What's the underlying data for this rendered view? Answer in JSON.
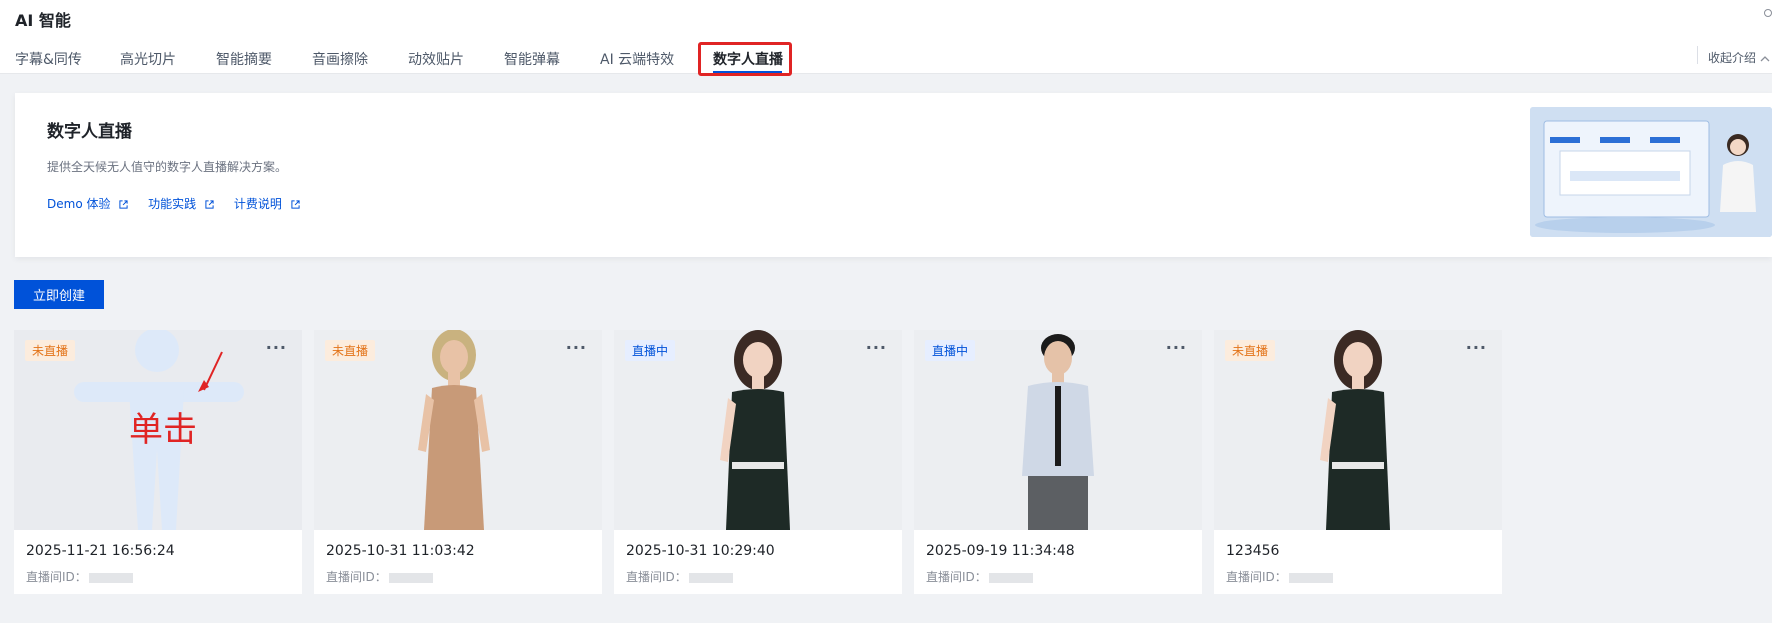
{
  "header": {
    "title": "AI 智能",
    "tabs": [
      {
        "label": "字幕&同传"
      },
      {
        "label": "高光切片"
      },
      {
        "label": "智能摘要"
      },
      {
        "label": "音画擦除"
      },
      {
        "label": "动效贴片"
      },
      {
        "label": "智能弹幕"
      },
      {
        "label": "AI 云端特效"
      },
      {
        "label": "数字人直播"
      }
    ],
    "active_tab": "数字人直播",
    "collapse_label": "收起介绍"
  },
  "intro": {
    "title": "数字人直播",
    "description": "提供全天候无人值守的数字人直播解决方案。",
    "links": [
      {
        "label": "Demo 体验"
      },
      {
        "label": "功能实践"
      },
      {
        "label": "计费说明"
      }
    ]
  },
  "actions": {
    "create_label": "立即创建"
  },
  "cards": [
    {
      "status": "未直播",
      "status_type": "off",
      "name": "2025-11-21 16:56:24",
      "id_label": "直播间ID：",
      "annotation": "单击"
    },
    {
      "status": "未直播",
      "status_type": "off",
      "name": "2025-10-31 11:03:42",
      "id_label": "直播间ID："
    },
    {
      "status": "直播中",
      "status_type": "live",
      "name": "2025-10-31 10:29:40",
      "id_label": "直播间ID："
    },
    {
      "status": "直播中",
      "status_type": "live",
      "name": "2025-09-19 11:34:48",
      "id_label": "直播间ID："
    },
    {
      "status": "未直播",
      "status_type": "off",
      "name": "123456",
      "id_label": "直播间ID："
    }
  ],
  "colors": {
    "accent": "#0052d9",
    "status_off": "#e37318",
    "status_live": "#0052d9",
    "highlight": "#e02424"
  }
}
